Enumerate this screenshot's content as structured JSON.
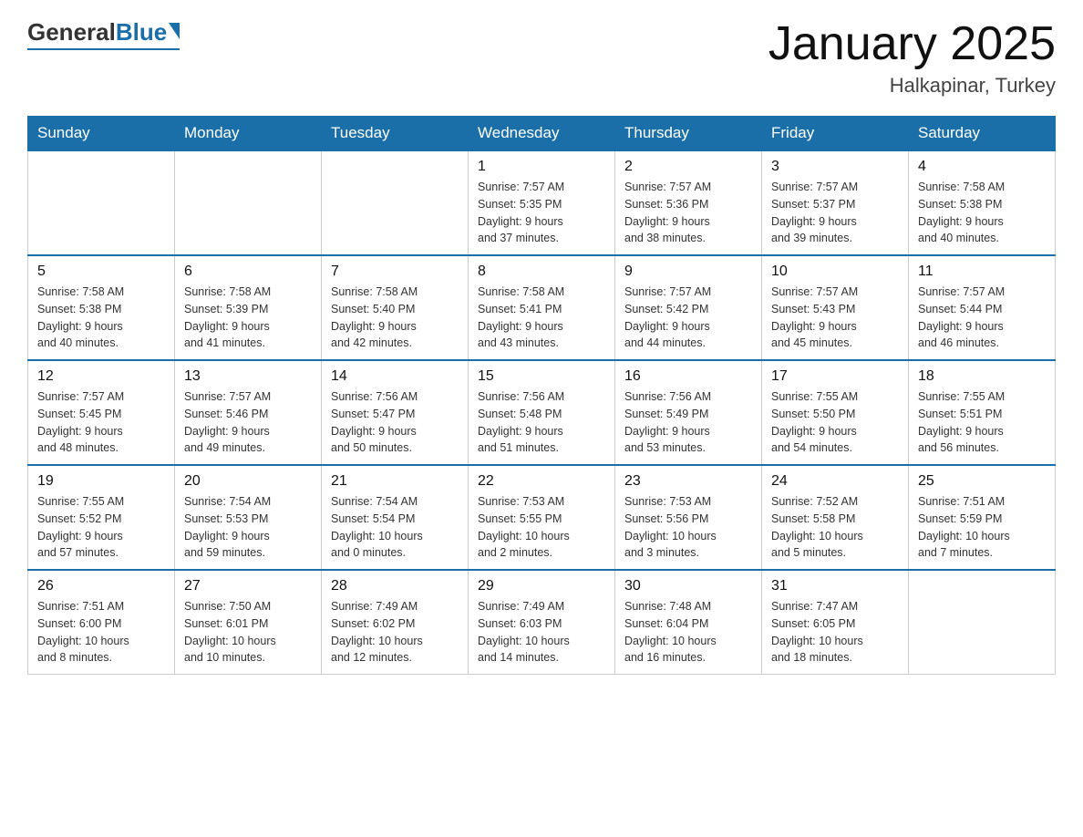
{
  "header": {
    "logo": {
      "general": "General",
      "blue": "Blue"
    },
    "title": "January 2025",
    "location": "Halkapinar, Turkey"
  },
  "weekdays": [
    "Sunday",
    "Monday",
    "Tuesday",
    "Wednesday",
    "Thursday",
    "Friday",
    "Saturday"
  ],
  "weeks": [
    [
      {
        "day": "",
        "info": ""
      },
      {
        "day": "",
        "info": ""
      },
      {
        "day": "",
        "info": ""
      },
      {
        "day": "1",
        "info": "Sunrise: 7:57 AM\nSunset: 5:35 PM\nDaylight: 9 hours\nand 37 minutes."
      },
      {
        "day": "2",
        "info": "Sunrise: 7:57 AM\nSunset: 5:36 PM\nDaylight: 9 hours\nand 38 minutes."
      },
      {
        "day": "3",
        "info": "Sunrise: 7:57 AM\nSunset: 5:37 PM\nDaylight: 9 hours\nand 39 minutes."
      },
      {
        "day": "4",
        "info": "Sunrise: 7:58 AM\nSunset: 5:38 PM\nDaylight: 9 hours\nand 40 minutes."
      }
    ],
    [
      {
        "day": "5",
        "info": "Sunrise: 7:58 AM\nSunset: 5:38 PM\nDaylight: 9 hours\nand 40 minutes."
      },
      {
        "day": "6",
        "info": "Sunrise: 7:58 AM\nSunset: 5:39 PM\nDaylight: 9 hours\nand 41 minutes."
      },
      {
        "day": "7",
        "info": "Sunrise: 7:58 AM\nSunset: 5:40 PM\nDaylight: 9 hours\nand 42 minutes."
      },
      {
        "day": "8",
        "info": "Sunrise: 7:58 AM\nSunset: 5:41 PM\nDaylight: 9 hours\nand 43 minutes."
      },
      {
        "day": "9",
        "info": "Sunrise: 7:57 AM\nSunset: 5:42 PM\nDaylight: 9 hours\nand 44 minutes."
      },
      {
        "day": "10",
        "info": "Sunrise: 7:57 AM\nSunset: 5:43 PM\nDaylight: 9 hours\nand 45 minutes."
      },
      {
        "day": "11",
        "info": "Sunrise: 7:57 AM\nSunset: 5:44 PM\nDaylight: 9 hours\nand 46 minutes."
      }
    ],
    [
      {
        "day": "12",
        "info": "Sunrise: 7:57 AM\nSunset: 5:45 PM\nDaylight: 9 hours\nand 48 minutes."
      },
      {
        "day": "13",
        "info": "Sunrise: 7:57 AM\nSunset: 5:46 PM\nDaylight: 9 hours\nand 49 minutes."
      },
      {
        "day": "14",
        "info": "Sunrise: 7:56 AM\nSunset: 5:47 PM\nDaylight: 9 hours\nand 50 minutes."
      },
      {
        "day": "15",
        "info": "Sunrise: 7:56 AM\nSunset: 5:48 PM\nDaylight: 9 hours\nand 51 minutes."
      },
      {
        "day": "16",
        "info": "Sunrise: 7:56 AM\nSunset: 5:49 PM\nDaylight: 9 hours\nand 53 minutes."
      },
      {
        "day": "17",
        "info": "Sunrise: 7:55 AM\nSunset: 5:50 PM\nDaylight: 9 hours\nand 54 minutes."
      },
      {
        "day": "18",
        "info": "Sunrise: 7:55 AM\nSunset: 5:51 PM\nDaylight: 9 hours\nand 56 minutes."
      }
    ],
    [
      {
        "day": "19",
        "info": "Sunrise: 7:55 AM\nSunset: 5:52 PM\nDaylight: 9 hours\nand 57 minutes."
      },
      {
        "day": "20",
        "info": "Sunrise: 7:54 AM\nSunset: 5:53 PM\nDaylight: 9 hours\nand 59 minutes."
      },
      {
        "day": "21",
        "info": "Sunrise: 7:54 AM\nSunset: 5:54 PM\nDaylight: 10 hours\nand 0 minutes."
      },
      {
        "day": "22",
        "info": "Sunrise: 7:53 AM\nSunset: 5:55 PM\nDaylight: 10 hours\nand 2 minutes."
      },
      {
        "day": "23",
        "info": "Sunrise: 7:53 AM\nSunset: 5:56 PM\nDaylight: 10 hours\nand 3 minutes."
      },
      {
        "day": "24",
        "info": "Sunrise: 7:52 AM\nSunset: 5:58 PM\nDaylight: 10 hours\nand 5 minutes."
      },
      {
        "day": "25",
        "info": "Sunrise: 7:51 AM\nSunset: 5:59 PM\nDaylight: 10 hours\nand 7 minutes."
      }
    ],
    [
      {
        "day": "26",
        "info": "Sunrise: 7:51 AM\nSunset: 6:00 PM\nDaylight: 10 hours\nand 8 minutes."
      },
      {
        "day": "27",
        "info": "Sunrise: 7:50 AM\nSunset: 6:01 PM\nDaylight: 10 hours\nand 10 minutes."
      },
      {
        "day": "28",
        "info": "Sunrise: 7:49 AM\nSunset: 6:02 PM\nDaylight: 10 hours\nand 12 minutes."
      },
      {
        "day": "29",
        "info": "Sunrise: 7:49 AM\nSunset: 6:03 PM\nDaylight: 10 hours\nand 14 minutes."
      },
      {
        "day": "30",
        "info": "Sunrise: 7:48 AM\nSunset: 6:04 PM\nDaylight: 10 hours\nand 16 minutes."
      },
      {
        "day": "31",
        "info": "Sunrise: 7:47 AM\nSunset: 6:05 PM\nDaylight: 10 hours\nand 18 minutes."
      },
      {
        "day": "",
        "info": ""
      }
    ]
  ]
}
